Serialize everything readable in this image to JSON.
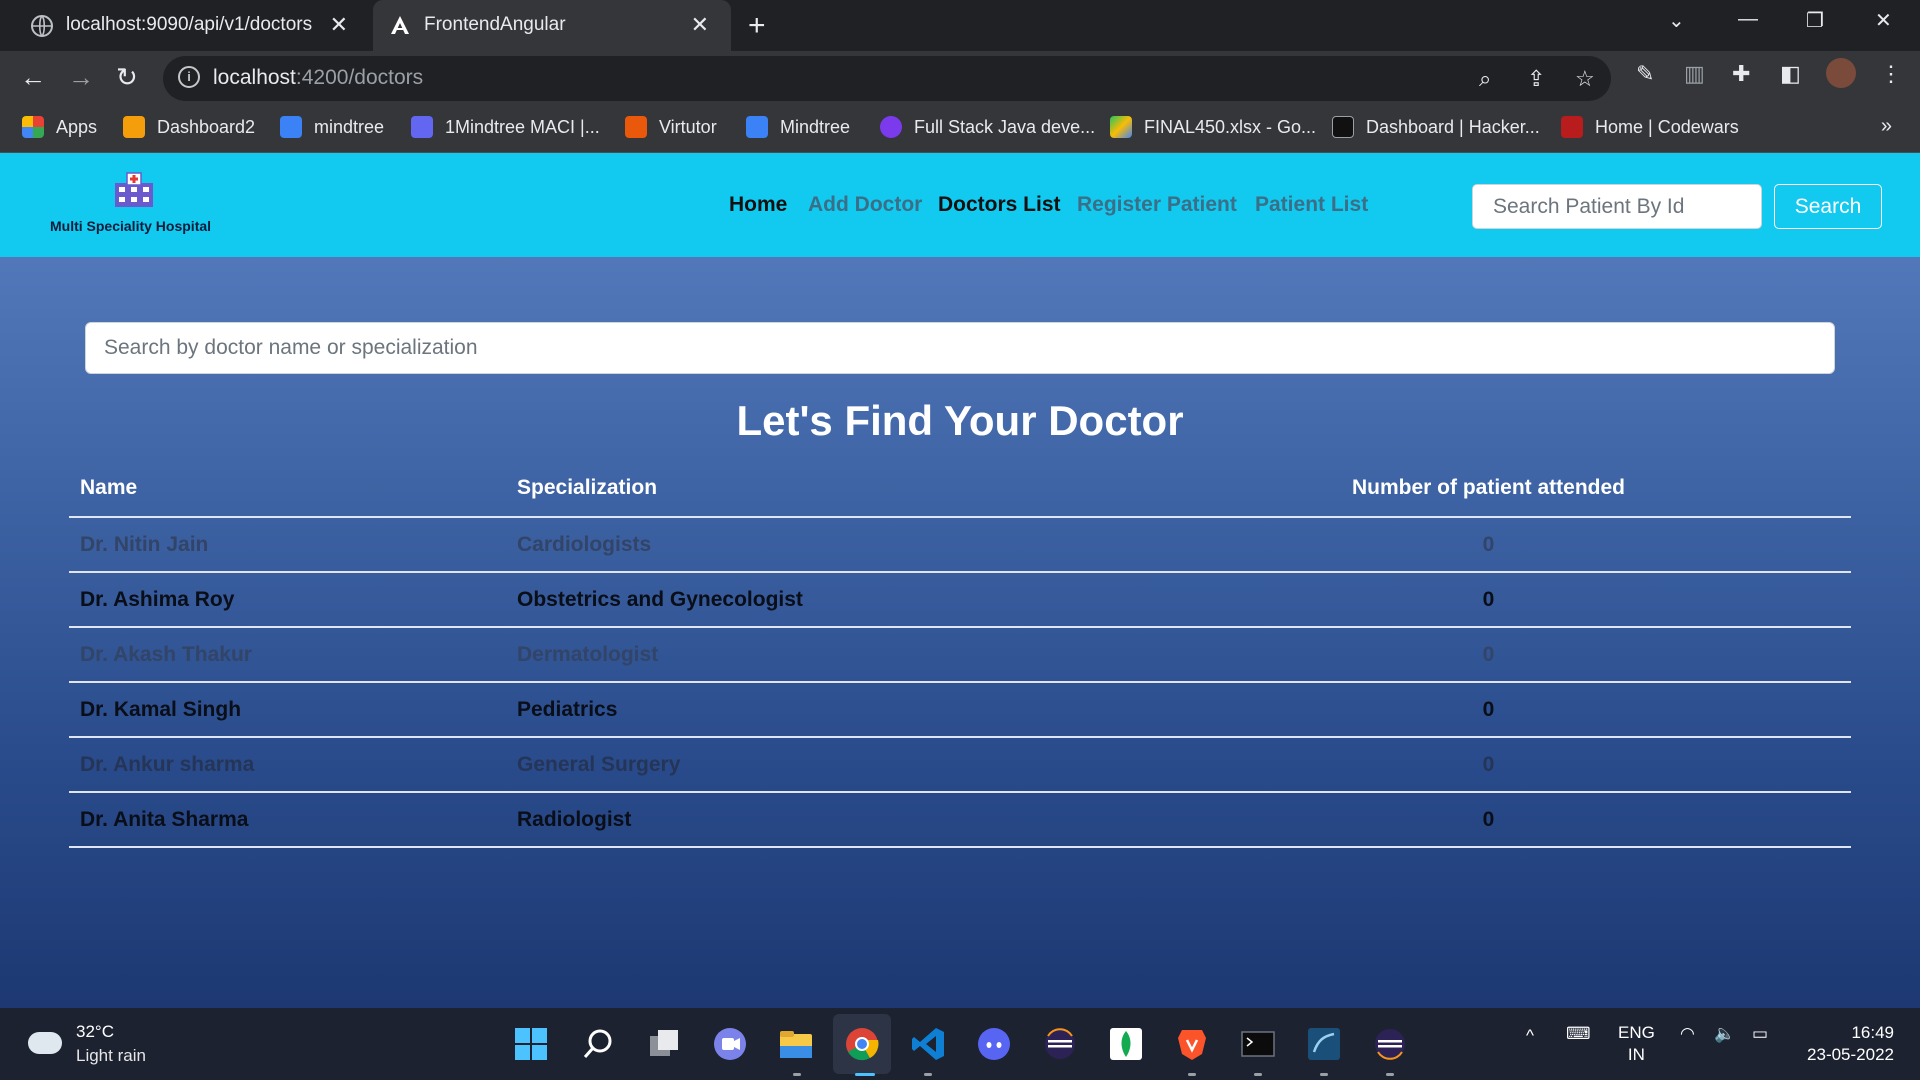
{
  "browser": {
    "tabs": [
      {
        "title": "localhost:9090/api/v1/doctors",
        "icon": "globe-icon"
      },
      {
        "title": "FrontendAngular",
        "icon": "angular-icon"
      }
    ],
    "url_host": "localhost",
    "url_path": ":4200/doctors",
    "bookmarks": [
      {
        "label": "Apps",
        "color": "#e94235"
      },
      {
        "label": "Dashboard2",
        "color": "#f59e0b"
      },
      {
        "label": "mindtree",
        "color": "#3b82f6"
      },
      {
        "label": "1Mindtree MACI |...",
        "color": "#6366f1"
      },
      {
        "label": "Virtutor",
        "color": "#ea580c"
      },
      {
        "label": "Mindtree",
        "color": "#3b82f6"
      },
      {
        "label": "Full Stack Java deve...",
        "color": "#7c3aed"
      },
      {
        "label": "FINAL450.xlsx - Go...",
        "color": "#22c55e"
      },
      {
        "label": "Dashboard | Hacker...",
        "color": "#111111"
      },
      {
        "label": "Home | Codewars",
        "color": "#b91c1c"
      }
    ],
    "bookmarks_more": "»"
  },
  "app": {
    "brand": "Multi Speciality Hospital",
    "nav": [
      {
        "label": "Home",
        "style": "dark"
      },
      {
        "label": "Add Doctor",
        "style": "muted"
      },
      {
        "label": "Doctors List",
        "style": "dark"
      },
      {
        "label": "Register Patient",
        "style": "muted"
      },
      {
        "label": "Patient List",
        "style": "muted"
      }
    ],
    "patient_search_placeholder": "Search Patient By Id",
    "search_button": "Search"
  },
  "main": {
    "search_placeholder": "Search by doctor name or specialization",
    "heading": "Let's Find Your Doctor",
    "columns": [
      "Name",
      "Specialization",
      "Number of patient attended"
    ],
    "doctors": [
      {
        "name": "Dr. Nitin Jain",
        "specialization": "Cardiologists",
        "patients": "0"
      },
      {
        "name": "Dr. Ashima Roy",
        "specialization": "Obstetrics and Gynecologist",
        "patients": "0"
      },
      {
        "name": "Dr. Akash Thakur",
        "specialization": "Dermatologist",
        "patients": "0"
      },
      {
        "name": "Dr. Kamal Singh",
        "specialization": "Pediatrics",
        "patients": "0"
      },
      {
        "name": "Dr. Ankur sharma",
        "specialization": "General Surgery",
        "patients": "0"
      },
      {
        "name": "Dr. Anita Sharma",
        "specialization": "Radiologist",
        "patients": "0"
      }
    ]
  },
  "taskbar": {
    "temperature": "32°C",
    "weather": "Light rain",
    "language": "ENG",
    "region": "IN",
    "time": "16:49",
    "date": "23-05-2022"
  },
  "colors": {
    "navbar": "#12c9f0",
    "page_gradient_top": "#5b81c4",
    "page_gradient_bottom": "#1d3872"
  }
}
